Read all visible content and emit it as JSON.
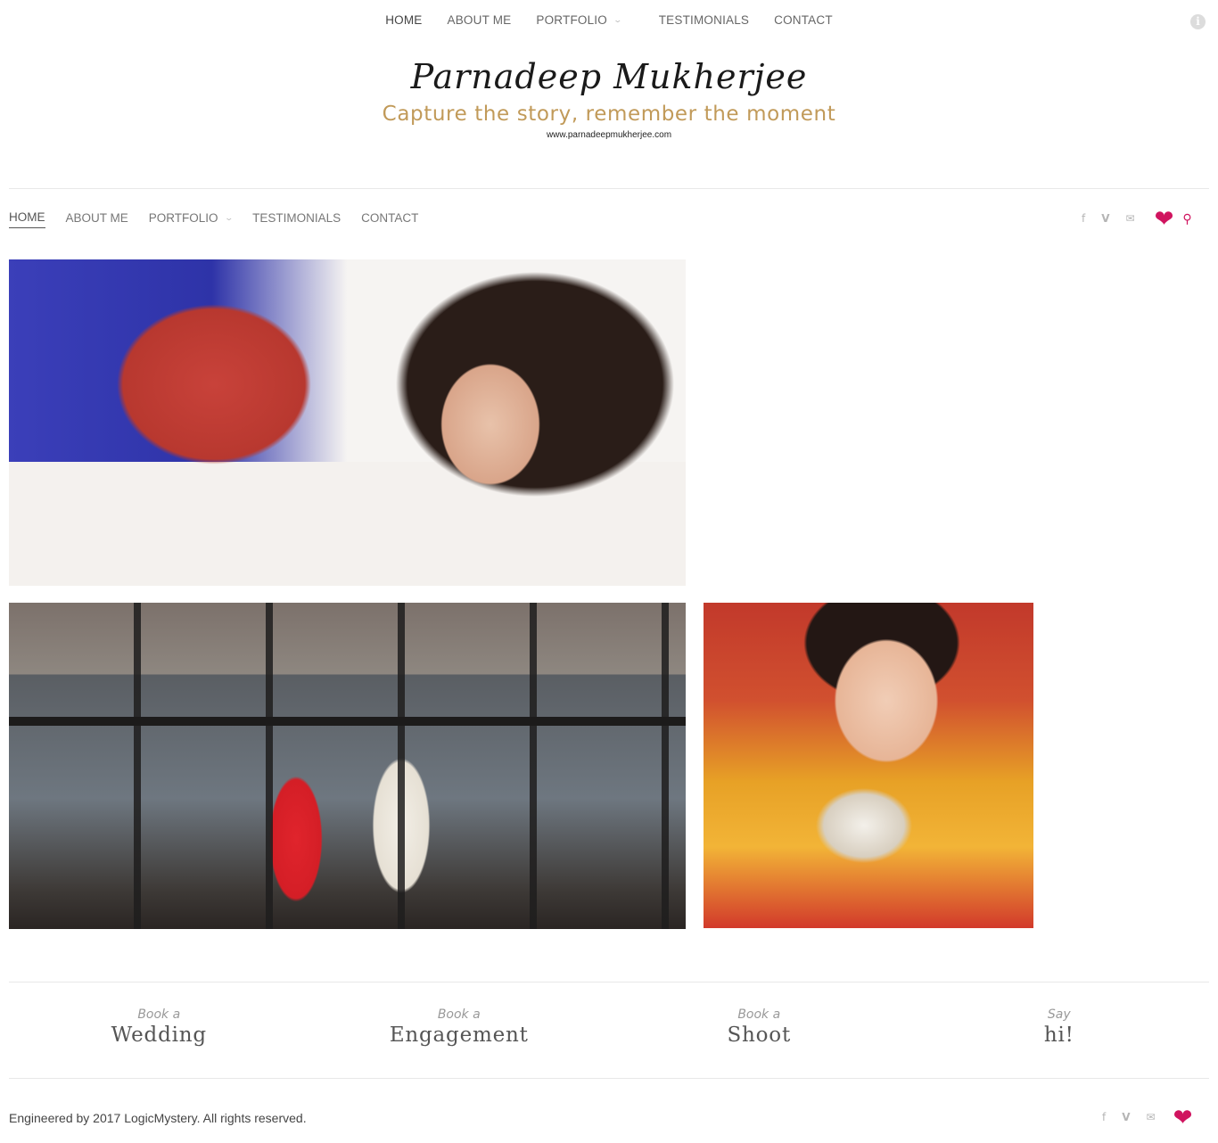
{
  "top_nav": {
    "items": [
      "HOME",
      "ABOUT ME",
      "PORTFOLIO",
      "TESTIMONIALS",
      "CONTACT"
    ],
    "active": "HOME"
  },
  "logo": {
    "name": "Parnadeep Mukherjee",
    "tagline": "Capture the story, remember the moment",
    "url": "www.parnadeepmukherjee.com"
  },
  "main_nav": {
    "items": [
      "HOME",
      "ABOUT ME",
      "PORTFOLIO",
      "TESTIMONIALS",
      "CONTACT"
    ],
    "active": "HOME"
  },
  "social": {
    "icons": [
      "facebook-icon",
      "vimeo-icon",
      "email-icon"
    ],
    "glyphs": [
      "f",
      "V",
      "✉"
    ]
  },
  "cta": [
    {
      "small": "Book a",
      "big": "Wedding"
    },
    {
      "small": "Book a",
      "big": "Engagement"
    },
    {
      "small": "Book a",
      "big": "Shoot"
    },
    {
      "small": "Say",
      "big": "hi!"
    }
  ],
  "footer": {
    "text": "Engineered by 2017 LogicMystery. All rights reserved."
  },
  "colors": {
    "accent": "#d0145f",
    "tagline": "#c19a59",
    "rule": "#e8e8e8"
  }
}
